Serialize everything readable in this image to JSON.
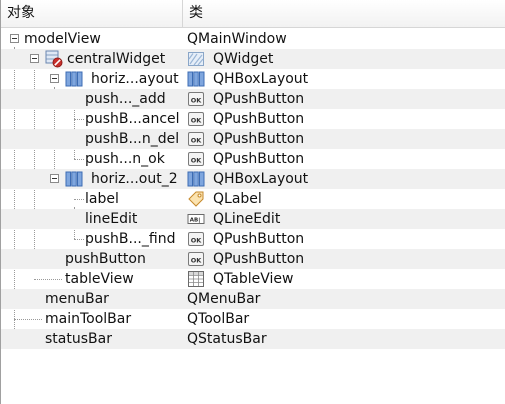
{
  "header": {
    "col_object": "对象",
    "col_class": "类"
  },
  "rows": [
    {
      "name": "modelView",
      "cls": "QMainWindow"
    },
    {
      "name": "centralWidget",
      "cls": "QWidget"
    },
    {
      "name": "horiz...ayout",
      "cls": "QHBoxLayout"
    },
    {
      "name": "push..._add",
      "cls": "QPushButton"
    },
    {
      "name": "pushB...ancel",
      "cls": "QPushButton"
    },
    {
      "name": "pushB...n_del",
      "cls": "QPushButton"
    },
    {
      "name": "push...n_ok",
      "cls": "QPushButton"
    },
    {
      "name": "horiz...out_2",
      "cls": "QHBoxLayout"
    },
    {
      "name": "label",
      "cls": "QLabel"
    },
    {
      "name": "lineEdit",
      "cls": "QLineEdit"
    },
    {
      "name": "pushB..._find",
      "cls": "QPushButton"
    },
    {
      "name": "pushButton",
      "cls": "QPushButton"
    },
    {
      "name": "tableView",
      "cls": "QTableView"
    },
    {
      "name": "menuBar",
      "cls": "QMenuBar"
    },
    {
      "name": "mainToolBar",
      "cls": "QToolBar"
    },
    {
      "name": "statusBar",
      "cls": "QStatusBar"
    }
  ]
}
